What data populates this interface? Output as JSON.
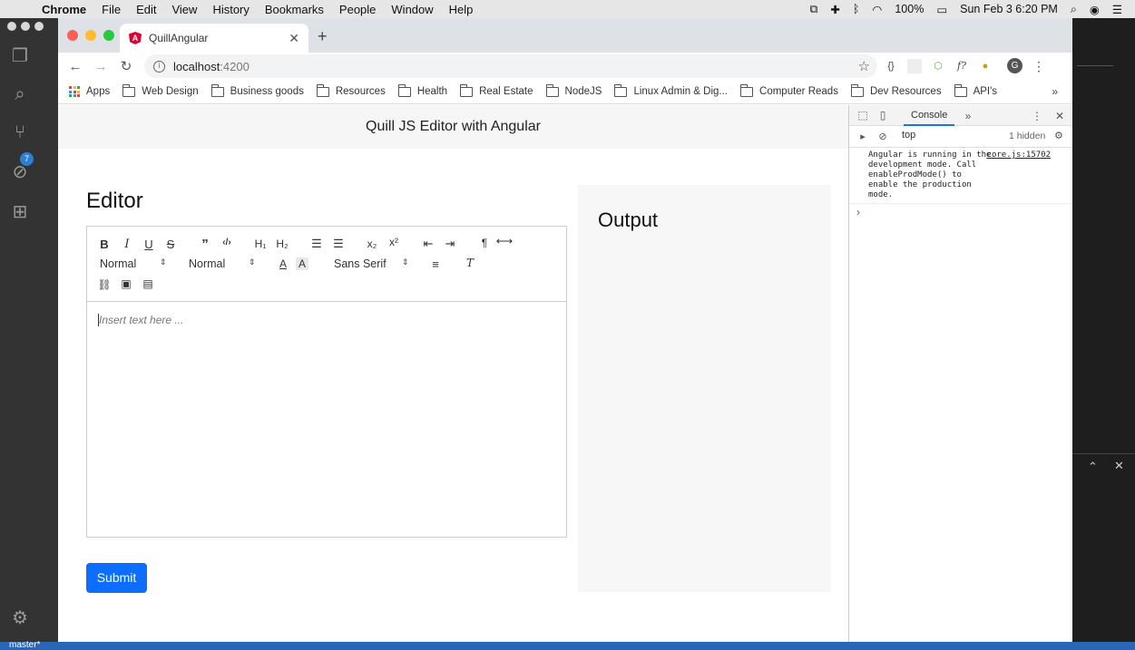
{
  "menubar": {
    "items": [
      "Chrome",
      "File",
      "Edit",
      "View",
      "History",
      "Bookmarks",
      "People",
      "Window",
      "Help"
    ],
    "battery": "100%",
    "clock": "Sun Feb 3  6:20 PM"
  },
  "vscode": {
    "scm_badge": "7",
    "branch": "master*"
  },
  "browser": {
    "tab_title": "QuillAngular",
    "url_host": "localhost",
    "url_port": ":4200",
    "extension_text": "f?",
    "profile_initial": "G",
    "bookmarks": [
      "Apps",
      "Web Design",
      "Business goods",
      "Resources",
      "Health",
      "Real Estate",
      "NodeJS",
      "Linux Admin & Dig...",
      "Computer Reads",
      "Dev Resources",
      "API's"
    ]
  },
  "page": {
    "header_title": "Quill JS Editor with Angular",
    "editor_title": "Editor",
    "output_title": "Output",
    "submit_label": "Submit",
    "editor_placeholder": "Insert text here ...",
    "toolbar": {
      "size_select": "Normal",
      "header_select": "Normal",
      "font_select": "Sans Serif"
    }
  },
  "devtools": {
    "tab_label": "Console",
    "context": "top",
    "hidden_count": "1 hidden",
    "log_message": "Angular is running in the development mode. Call enableProdMode() to enable the production mode.",
    "log_source": "core.js:15702"
  }
}
